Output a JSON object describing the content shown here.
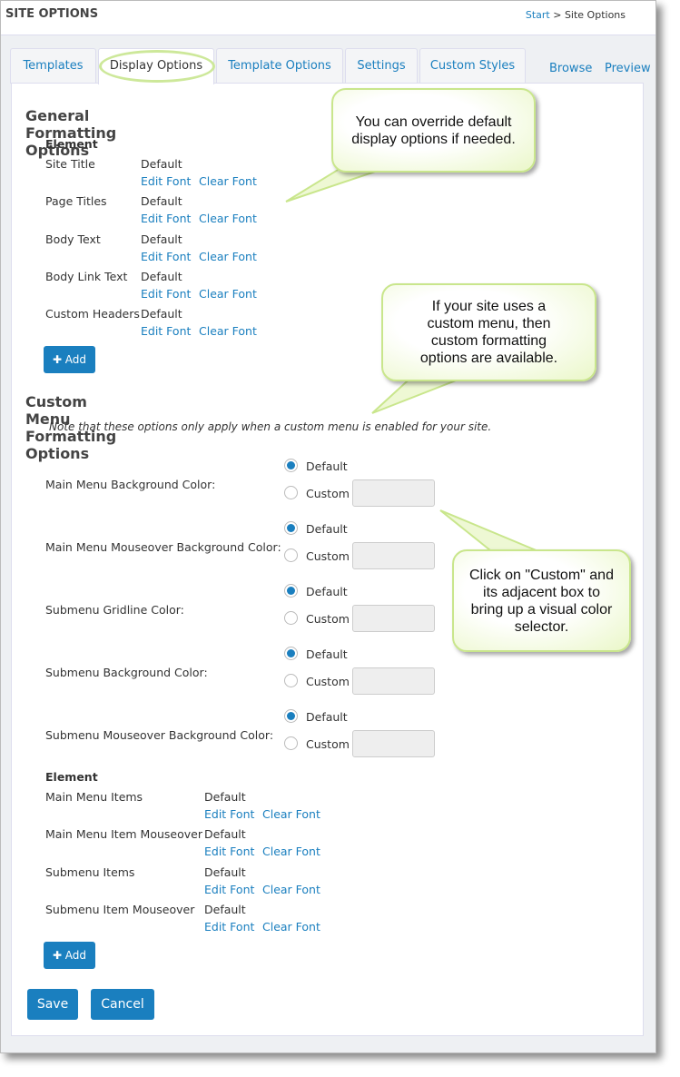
{
  "header": {
    "title": "SITE OPTIONS",
    "breadcrumb": {
      "start": "Start",
      "separator": " > ",
      "current": "Site Options"
    }
  },
  "tabs": [
    {
      "label": "Templates"
    },
    {
      "label": "Display Options",
      "active": true
    },
    {
      "label": "Template Options"
    },
    {
      "label": "Settings"
    },
    {
      "label": "Custom Styles"
    }
  ],
  "links": {
    "browse": "Browse",
    "preview": "Preview"
  },
  "general": {
    "heading": "General Formatting Options",
    "col": "Element",
    "edit": "Edit Font",
    "clear": "Clear Font",
    "add": "✚ Add",
    "rows": [
      {
        "name": "Site Title",
        "value": "Default"
      },
      {
        "name": "Page Titles",
        "value": "Default"
      },
      {
        "name": "Body Text",
        "value": "Default"
      },
      {
        "name": "Body Link Text",
        "value": "Default"
      },
      {
        "name": "Custom Headers",
        "value": "Default"
      }
    ]
  },
  "custom_menu": {
    "heading": "Custom Menu Formatting Options",
    "note": "Note that these options only apply when a custom menu is enabled for your site.",
    "default_label": "Default",
    "custom_label": "Custom",
    "colors": [
      {
        "label": "Main Menu Background Color:",
        "selected": "Default"
      },
      {
        "label": "Main Menu Mouseover Background Color:",
        "selected": "Default"
      },
      {
        "label": "Submenu Gridline Color:",
        "selected": "Default"
      },
      {
        "label": "Submenu Background Color:",
        "selected": "Default"
      },
      {
        "label": "Submenu Mouseover Background Color:",
        "selected": "Default"
      }
    ],
    "col": "Element",
    "add": "✚ Add",
    "rows": [
      {
        "name": "Main Menu Items",
        "value": "Default"
      },
      {
        "name": "Main Menu Item Mouseover",
        "value": "Default"
      },
      {
        "name": "Submenu Items",
        "value": "Default"
      },
      {
        "name": "Submenu Item Mouseover",
        "value": "Default"
      }
    ]
  },
  "actions": {
    "save": "Save",
    "cancel": "Cancel"
  },
  "callouts": [
    "You can override default display options if needed.",
    "If your site uses a custom menu, then custom formatting options are available.",
    "Click on \"Custom\" and its adjacent box to bring up a visual color selector."
  ],
  "colors": {
    "accent": "#1a7fbf",
    "callout_border": "#c9e68c"
  }
}
